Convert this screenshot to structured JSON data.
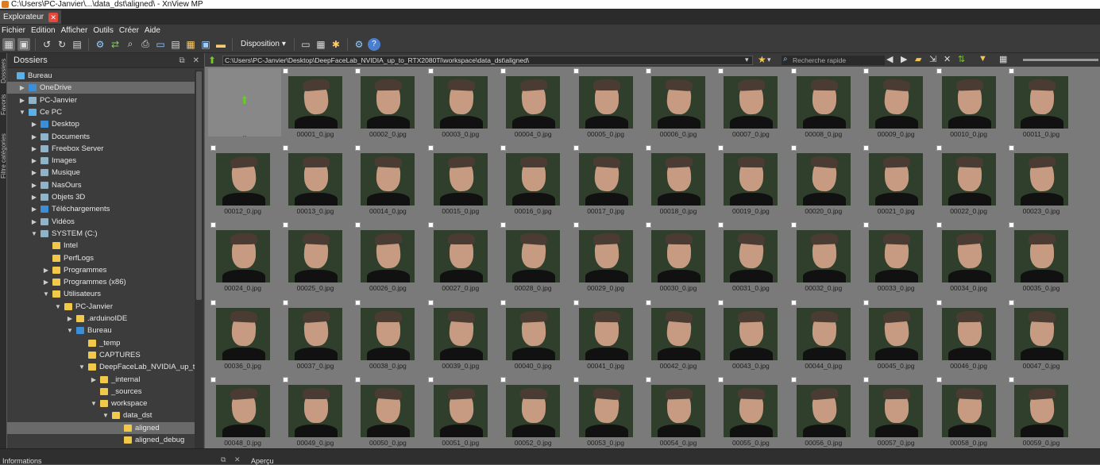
{
  "window": {
    "title": "C:\\Users\\PC-Janvier\\...\\data_dst\\aligned\\ - XnView MP"
  },
  "tab": {
    "label": "Explorateur"
  },
  "menu": [
    "Fichier",
    "Edition",
    "Afficher",
    "Outils",
    "Créer",
    "Aide"
  ],
  "toolbar": {
    "disposition_label": "Disposition"
  },
  "side_tabs": [
    "Dossiers",
    "Favoris",
    "Filtre catégories"
  ],
  "folders": {
    "title": "Dossiers",
    "items": [
      "Bureau",
      "OneDrive",
      "PC-Janvier",
      "Ce PC",
      "Desktop",
      "Documents",
      "Freebox Server",
      "Images",
      "Musique",
      "NasOurs",
      "Objets 3D",
      "Téléchargements",
      "Vidéos",
      "SYSTEM (C:)",
      "Intel",
      "PerfLogs",
      "Programmes",
      "Programmes (x86)",
      "Utilisateurs",
      "PC-Janvier",
      ".arduinoIDE",
      "Bureau",
      "_temp",
      "CAPTURES",
      "DeepFaceLab_NVIDIA_up_to_R",
      "_internal",
      "_sources",
      "workspace",
      "data_dst",
      "aligned",
      "aligned_debug"
    ]
  },
  "path": {
    "value": "C:\\Users\\PC-Janvier\\Desktop\\DeepFaceLab_NVIDIA_up_to_RTX2080Ti\\workspace\\data_dst\\aligned\\"
  },
  "search": {
    "placeholder": "Recherche rapide"
  },
  "files": {
    "parent_label": "..",
    "names": [
      "00001_0.jpg",
      "00002_0.jpg",
      "00003_0.jpg",
      "00004_0.jpg",
      "00005_0.jpg",
      "00006_0.jpg",
      "00007_0.jpg",
      "00008_0.jpg",
      "00009_0.jpg",
      "00010_0.jpg",
      "00011_0.jpg",
      "00012_0.jpg",
      "00013_0.jpg",
      "00014_0.jpg",
      "00015_0.jpg",
      "00016_0.jpg",
      "00017_0.jpg",
      "00018_0.jpg",
      "00019_0.jpg",
      "00020_0.jpg",
      "00021_0.jpg",
      "00022_0.jpg",
      "00023_0.jpg",
      "00024_0.jpg",
      "00025_0.jpg",
      "00026_0.jpg",
      "00027_0.jpg",
      "00028_0.jpg",
      "00029_0.jpg",
      "00030_0.jpg",
      "00031_0.jpg",
      "00032_0.jpg",
      "00033_0.jpg",
      "00034_0.jpg",
      "00035_0.jpg",
      "00036_0.jpg",
      "00037_0.jpg",
      "00038_0.jpg",
      "00039_0.jpg",
      "00040_0.jpg",
      "00041_0.jpg",
      "00042_0.jpg",
      "00043_0.jpg",
      "00044_0.jpg",
      "00045_0.jpg",
      "00046_0.jpg",
      "00047_0.jpg",
      "00048_0.jpg",
      "00049_0.jpg",
      "00050_0.jpg",
      "00051_0.jpg",
      "00052_0.jpg",
      "00053_0.jpg",
      "00054_0.jpg",
      "00055_0.jpg",
      "00056_0.jpg",
      "00057_0.jpg",
      "00058_0.jpg",
      "00059_0.jpg"
    ]
  },
  "bottom": {
    "informations": "Informations",
    "apercu": "Aperçu"
  }
}
